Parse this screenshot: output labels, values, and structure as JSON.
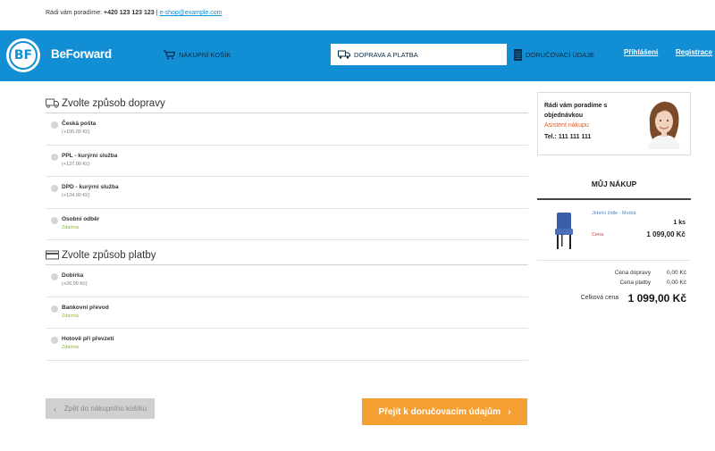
{
  "topbar": {
    "help_text": "Rádi vám poradíme:",
    "phone": "+420 123 123 123",
    "separator": "|",
    "email": "e-shop@example.com"
  },
  "header": {
    "brand": "BeForward",
    "logo_mark": "BF",
    "steps": {
      "cart": "Nákupní košík",
      "shipping": "Doprava a platba",
      "delivery": "Doručovací údaje"
    },
    "login": "Přihlášení",
    "register": "Registrace",
    "colors": {
      "primary": "#128fd4",
      "accent": "#f5a033"
    }
  },
  "shipping": {
    "title": "Zvolte způsob dopravy",
    "icon": "truck-icon",
    "options": [
      {
        "name": "Česká pošta",
        "price": "(+105.00 Kč)"
      },
      {
        "name": "PPL - kurýrní služba",
        "price": "(+137.00 Kč)"
      },
      {
        "name": "DPD - kurýrní služba",
        "price": "(+124.00 Kč)"
      },
      {
        "name": "Osobní odběr",
        "price": "Zdarma"
      }
    ]
  },
  "payment": {
    "title": "Zvolte způsob platby",
    "icon": "credit-card-icon",
    "options": [
      {
        "name": "Dobírka",
        "price": "(+26.00 Kč)"
      },
      {
        "name": "Bankovní převod",
        "price": "Zdarma"
      },
      {
        "name": "Hotově při převzetí",
        "price": "Zdarma"
      }
    ]
  },
  "buttons": {
    "back": "Zpět do nákupního košíku",
    "next": "Přejít k doručovacím údajům"
  },
  "help_box": {
    "title": "Rádi vám poradíme s objednávkou",
    "role": "Asistent nákupu",
    "phone": "Tel.: 111 111 111"
  },
  "cart": {
    "title": "Můj nákup",
    "item": {
      "name": "Jídelní židle - Modrá",
      "qty": "1 ks",
      "price_label": "Cena",
      "price": "1 099,00 Kč"
    },
    "shipping_label": "Cena dopravy",
    "shipping_value": "0,00 Kč",
    "payment_label": "Cena platby",
    "payment_value": "0,00 Kč",
    "total_label": "Celková cena",
    "total_value": "1 099,00 Kč"
  }
}
